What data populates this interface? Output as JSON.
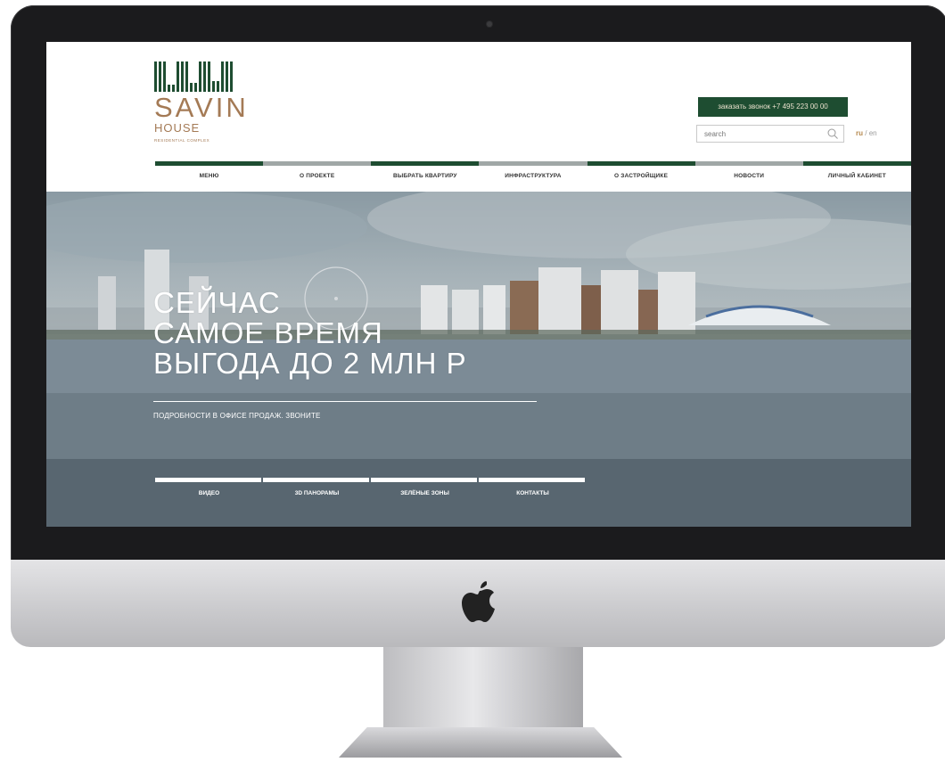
{
  "logo": {
    "name": "SAVIN",
    "house": "HOUSE",
    "subtitle": "RESIDENTIAL COMPLEX"
  },
  "header": {
    "callback_label": "заказать звонок",
    "phone": "+7 495 223 00 00",
    "search_placeholder": "search",
    "lang_ru": "ru",
    "lang_sep": "/",
    "lang_en": "en"
  },
  "nav": {
    "items": [
      {
        "label": "МЕНЮ",
        "color": "#1e4d31"
      },
      {
        "label": "О ПРОЕКТЕ",
        "color": "#a0a7a6"
      },
      {
        "label": "ВЫБРАТЬ КВАРТИРУ",
        "color": "#1e4d31"
      },
      {
        "label": "ИНФРАСТРУКТУРА",
        "color": "#a0a7a6"
      },
      {
        "label": "О ЗАСТРОЙЩИКЕ",
        "color": "#1e4d31"
      },
      {
        "label": "НОВОСТИ",
        "color": "#a0a7a6"
      },
      {
        "label": "ЛИЧНЫЙ КАБИНЕТ",
        "color": "#1e4d31"
      }
    ]
  },
  "hero": {
    "title_lines": [
      "СЕЙЧАС",
      "САМОЕ ВРЕМЯ",
      "ВЫГОДА ДО 2 МЛН Р"
    ],
    "subtitle": "ПОДРОБНОСТИ В ОФИСЕ ПРОДАЖ. ЗВОНИТЕ",
    "tabs": [
      "ВИДЕО",
      "3D ПАНОРАМЫ",
      "ЗЕЛЁНЫЕ ЗОНЫ",
      "КОНТАКТЫ"
    ]
  },
  "colors": {
    "brand_green": "#1e4d31",
    "brand_gold": "#a47a55",
    "nav_gray": "#a0a7a6"
  }
}
